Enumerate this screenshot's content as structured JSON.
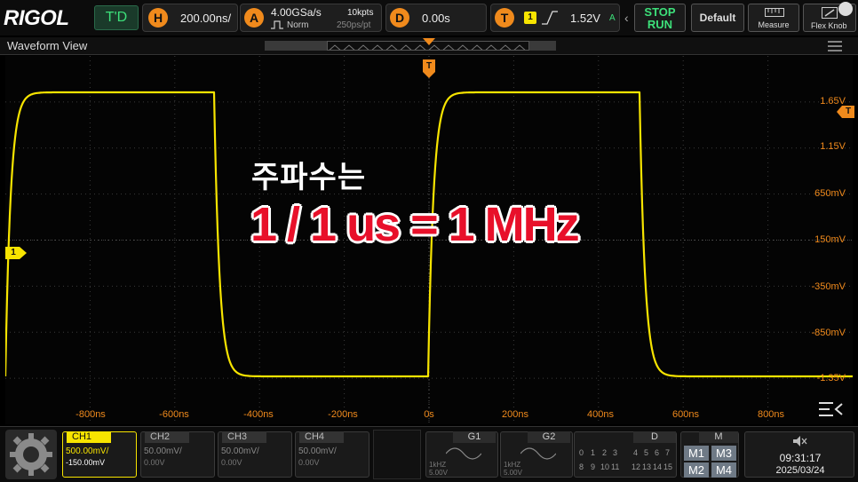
{
  "topbar": {
    "logo": "RIGOL",
    "mode": "T'D",
    "horizontal": {
      "badge": "H",
      "value": "200.00ns/"
    },
    "acquire": {
      "badge": "A",
      "sample_rate": "4.00GSa/s",
      "mode": "Norm",
      "points": "10kpts",
      "resolution": "250ps/pt"
    },
    "delay": {
      "badge": "D",
      "value": "0.00s"
    },
    "trigger": {
      "badge": "T",
      "source": "1",
      "level": "1.52V",
      "suffix": "A"
    },
    "stop_label": "STOP",
    "run_label": "RUN",
    "default_label": "Default",
    "measure_label": "Measure",
    "flex_label": "Flex Knob"
  },
  "waveform": {
    "title": "Waveform View",
    "trigger_marker": "T",
    "channel_marker": "1",
    "overlay_line1": "주파수는",
    "overlay_line2": "1 / 1 us = 1 MHz",
    "y_labels": [
      "1.65V",
      "1.15V",
      "650mV",
      "150mV",
      "-350mV",
      "-850mV",
      "-1.35V"
    ],
    "x_labels": [
      "-800ns",
      "-600ns",
      "-400ns",
      "-200ns",
      "0s",
      "200ns",
      "400ns",
      "600ns",
      "800ns"
    ],
    "trace_color": "#f7e400",
    "accent_color": "#f08a1c"
  },
  "bottombar": {
    "channels": [
      {
        "name": "CH1",
        "scale": "500.00mV/",
        "offset": "-150.00mV",
        "active": true
      },
      {
        "name": "CH2",
        "scale": "50.00mV/",
        "offset": "0.00V",
        "active": false
      },
      {
        "name": "CH3",
        "scale": "50.00mV/",
        "offset": "0.00V",
        "active": false
      },
      {
        "name": "CH4",
        "scale": "50.00mV/",
        "offset": "0.00V",
        "active": false
      }
    ],
    "generators": [
      {
        "name": "G1",
        "freq": "1kHZ",
        "amp": "5.00V"
      },
      {
        "name": "G2",
        "freq": "1kHZ",
        "amp": "5.00V"
      }
    ],
    "digital": {
      "label": "D",
      "row1": [
        "0",
        "1",
        "2",
        "3",
        "4",
        "5",
        "6",
        "7"
      ],
      "row2": [
        "8",
        "9",
        "10",
        "11",
        "12",
        "13",
        "14",
        "15"
      ]
    },
    "math": {
      "label": "M",
      "buttons": [
        "M1",
        "M3",
        "M2",
        "M4"
      ]
    },
    "time": "09:31:17",
    "date": "2025/03/24"
  }
}
